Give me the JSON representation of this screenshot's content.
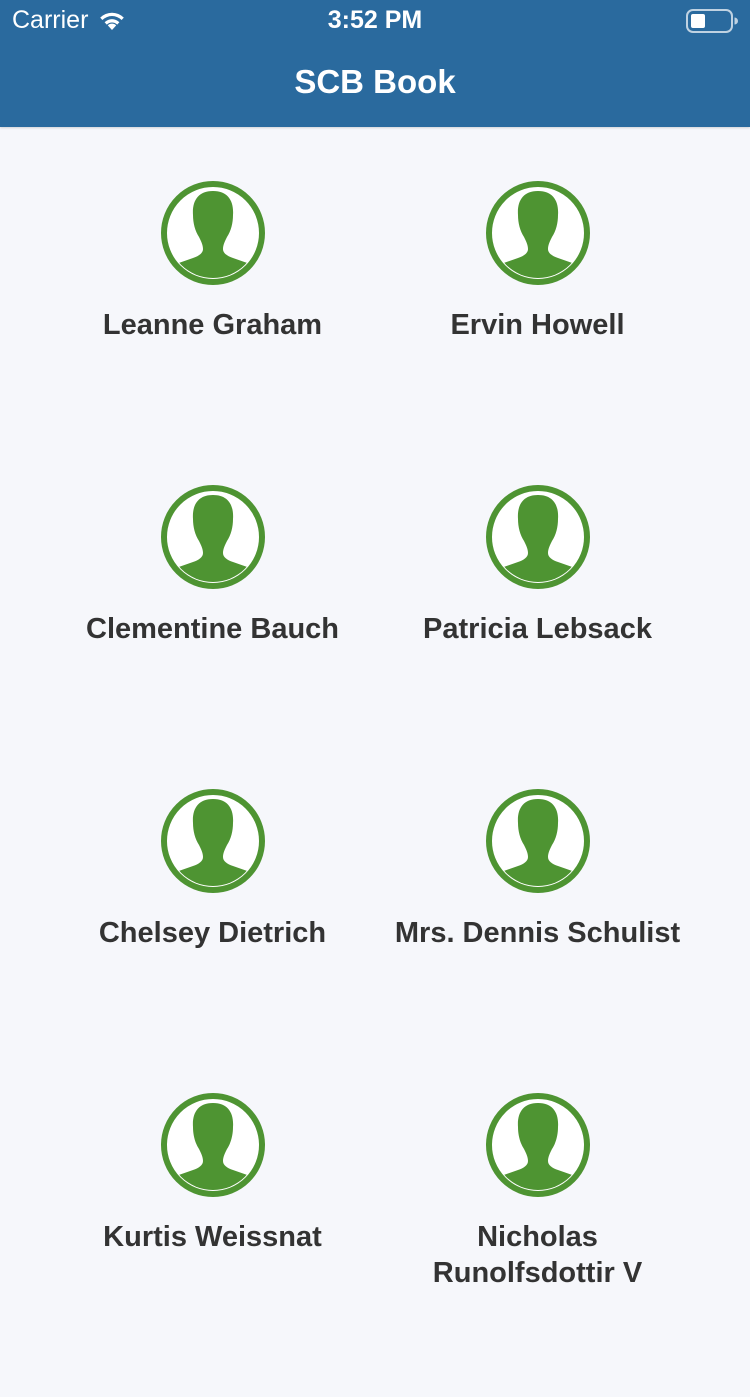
{
  "status_bar": {
    "carrier": "Carrier",
    "time": "3:52 PM",
    "wifi_icon": "wifi-icon",
    "battery_icon": "battery-icon"
  },
  "header": {
    "title": "SCB Book",
    "background_color": "#2a6a9e"
  },
  "avatar": {
    "icon": "user-avatar-icon",
    "color": "#4e9432"
  },
  "contacts": [
    {
      "name": "Leanne Graham"
    },
    {
      "name": "Ervin Howell"
    },
    {
      "name": "Clementine Bauch"
    },
    {
      "name": "Patricia Lebsack"
    },
    {
      "name": "Chelsey Dietrich"
    },
    {
      "name": "Mrs. Dennis Schulist"
    },
    {
      "name": "Kurtis Weissnat"
    },
    {
      "name": "Nicholas Runolfsdottir V"
    }
  ]
}
